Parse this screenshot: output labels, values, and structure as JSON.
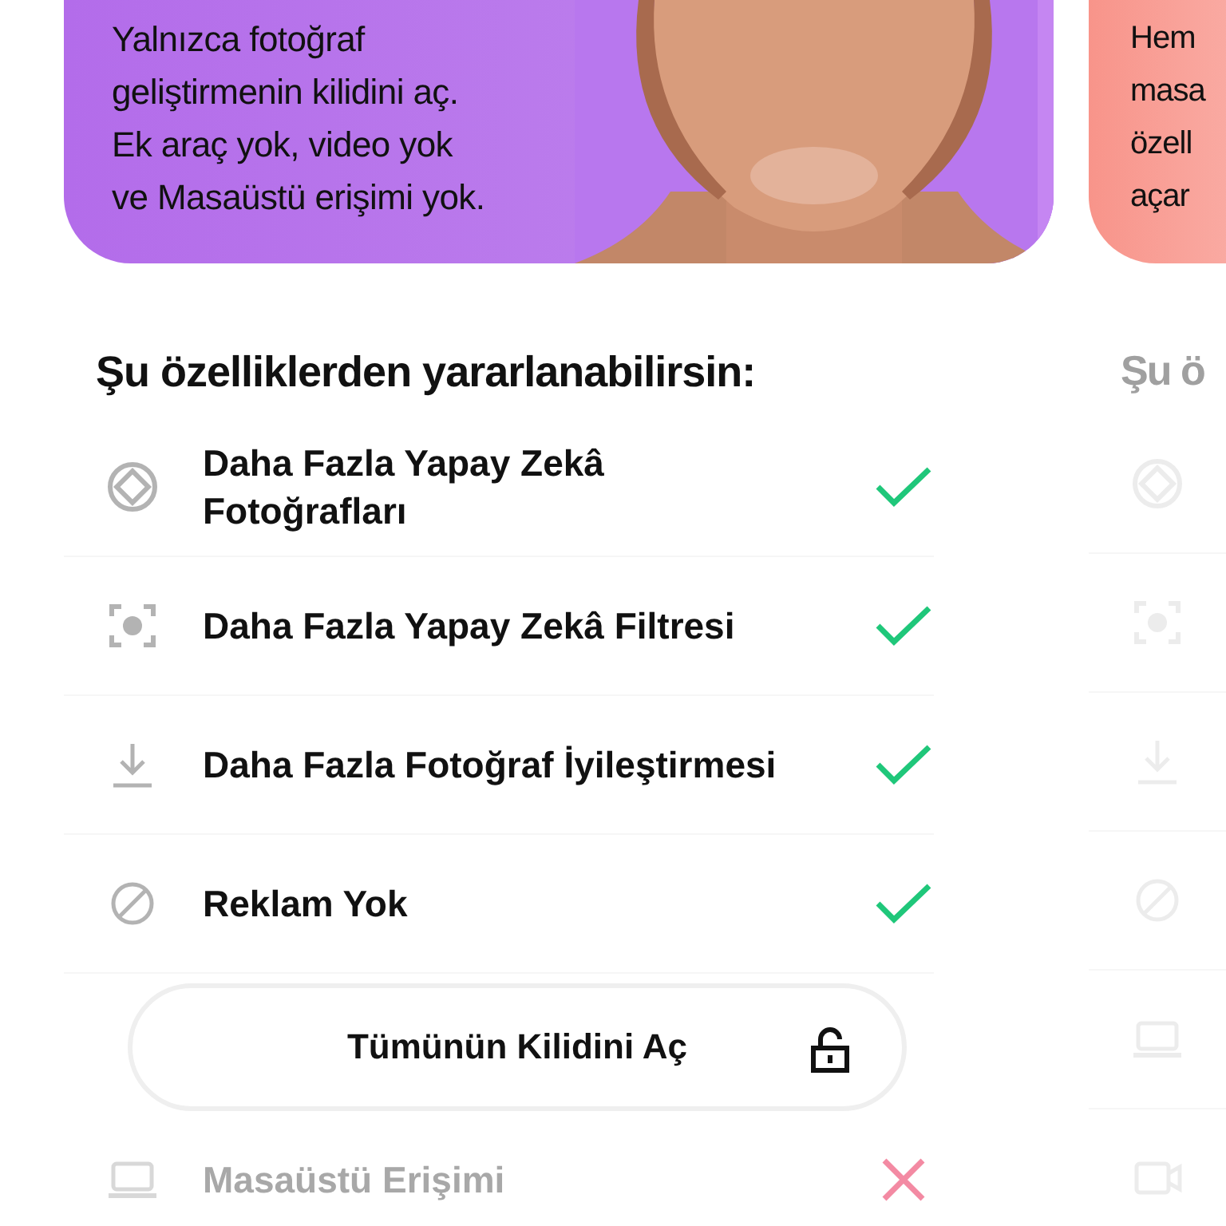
{
  "plans": [
    {
      "selected": true,
      "color": "#b36cea",
      "description": "Yalnızca fotoğraf\ngeliştirmenin kilidini aç.\nEk araç yok, video yok\nve Masaüstü erişimi yok.",
      "picture": {
        "kind": "picture"
      },
      "heading": "Şu özelliklerden yararlanabilirsin:",
      "features": [
        {
          "kind": "orbit",
          "label": "Daha Fazla Yapay Zekâ\nFotoğrafları",
          "included": true
        },
        {
          "kind": "face-scan",
          "label": "Daha Fazla Yapay Zekâ Filtresi",
          "included": true
        },
        {
          "kind": "download",
          "label": "Daha Fazla Fotoğraf İyileştirmesi",
          "included": true
        },
        {
          "kind": "block",
          "label": "Reklam Yok",
          "included": true
        }
      ],
      "button": {
        "label": "Tümünün Kilidini Aç"
      },
      "extra_features": [
        {
          "kind": "laptop",
          "label": "Masaüstü Erişimi",
          "included": false
        }
      ]
    },
    {
      "selected": false,
      "color": "#f8948a",
      "description": "Hem\nmasa\nözell\naçar",
      "heading": "Şu ö",
      "features": [
        {
          "kind": "orbit"
        },
        {
          "kind": "face-scan"
        },
        {
          "kind": "download"
        },
        {
          "kind": "block"
        },
        {
          "kind": "laptop"
        },
        {
          "kind": "video"
        }
      ]
    }
  ]
}
